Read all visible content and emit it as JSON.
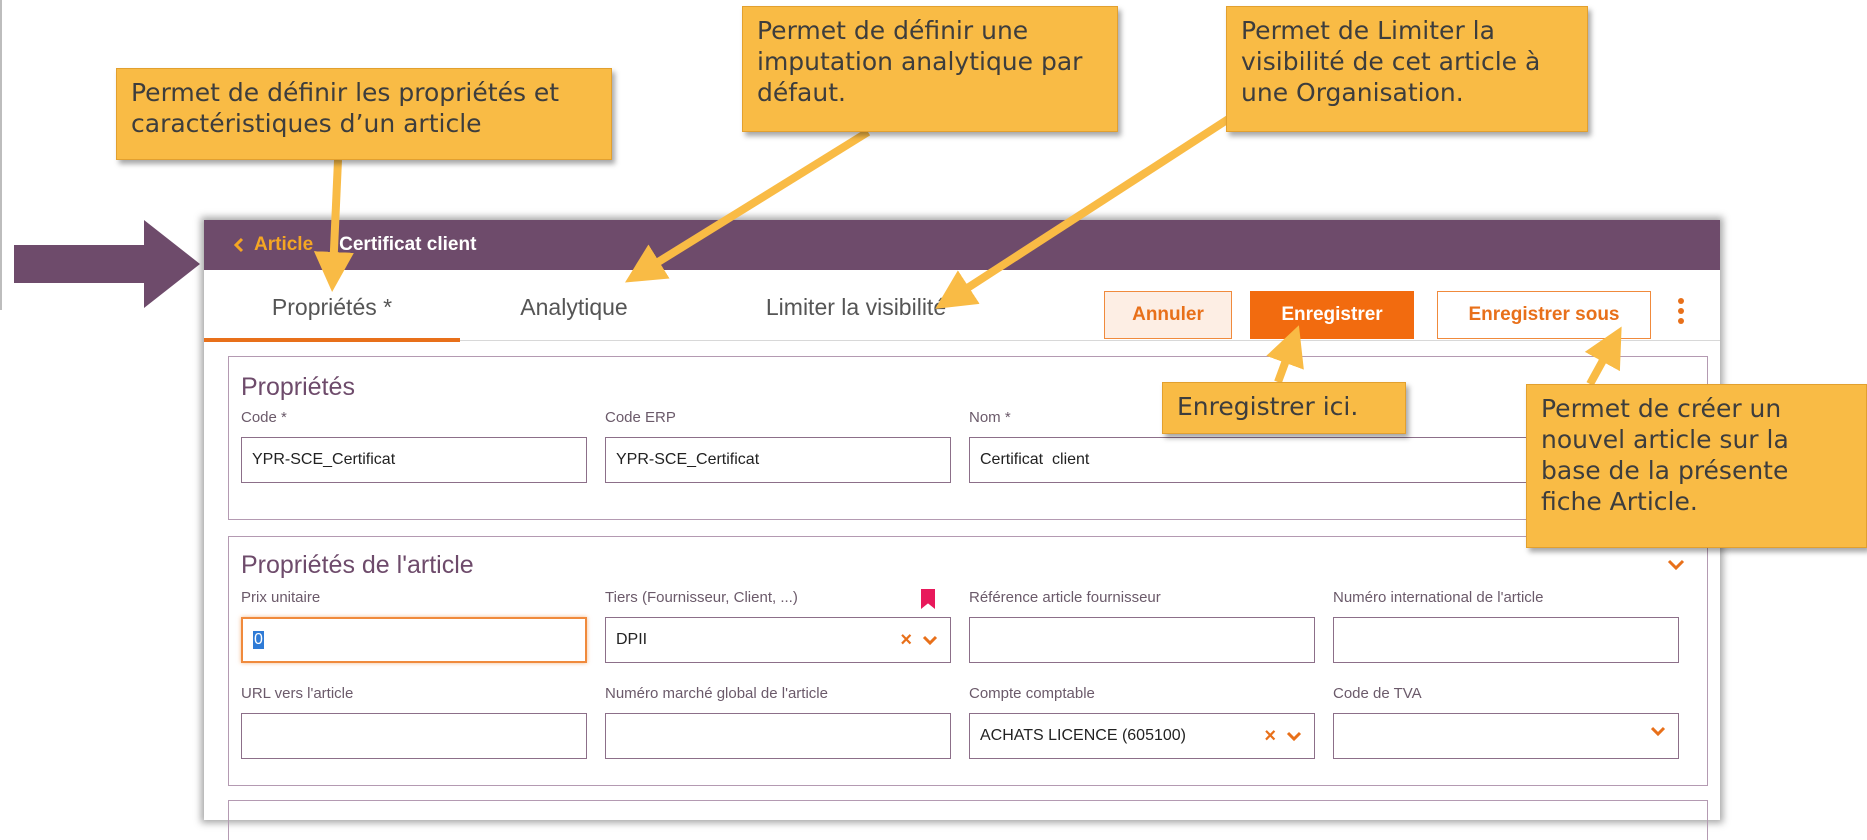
{
  "header": {
    "back_label": "Article",
    "current": "Certificat client"
  },
  "tabs": [
    {
      "label": "Propriétés *",
      "active": true
    },
    {
      "label": "Analytique",
      "active": false
    },
    {
      "label": "Limiter la visibilité",
      "active": false
    }
  ],
  "actions": {
    "cancel": "Annuler",
    "save": "Enregistrer",
    "save_as": "Enregistrer sous"
  },
  "section_properties": {
    "title": "Propriétés",
    "code_label": "Code *",
    "code_value": "YPR-SCE_Certificat",
    "erp_label": "Code ERP",
    "erp_value": "YPR-SCE_Certificat",
    "name_label": "Nom *",
    "name_value": "Certificat  client"
  },
  "section_article": {
    "title": "Propriétés de l'article",
    "unit_price_label": "Prix unitaire",
    "unit_price_value": "0",
    "third_party_label": "Tiers (Fournisseur, Client, ...)",
    "third_party_value": "DPII",
    "supplier_ref_label": "Référence article fournisseur",
    "supplier_ref_value": "",
    "intl_number_label": "Numéro international de l'article",
    "intl_number_value": "",
    "url_label": "URL vers l'article",
    "url_value": "",
    "market_number_label": "Numéro marché global de l'article",
    "market_number_value": "",
    "account_label": "Compte comptable",
    "account_value": "ACHATS LICENCE (605100)",
    "vat_label": "Code de TVA",
    "vat_value": ""
  },
  "callouts": {
    "properties": "Permet de définir les propriétés et caractéristiques d’un article",
    "analytics": "Permet de définir une imputation analytique par défaut.",
    "visibility": "Permet de Limiter la visibilité de cet article à une Organisation.",
    "save": "Enregistrer ici.",
    "save_as": "Permet de créer un nouvel article sur la base de la présente fiche Article."
  },
  "colors": {
    "header_bg": "#6e4b6b",
    "accent": "#f26b0f",
    "callout_bg": "#f9bb45",
    "bookmark": "#e8195b"
  },
  "icons": [
    "chevron-left-icon",
    "kebab-menu-icon",
    "chevron-down-icon",
    "clear-x-icon",
    "bookmark-icon",
    "pointer-arrow-icon"
  ]
}
